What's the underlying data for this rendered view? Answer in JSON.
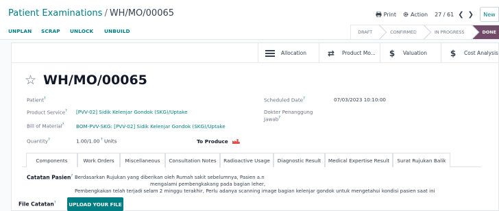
{
  "breadcrumb": {
    "parent": "Patient Examinations",
    "separator": "/",
    "current": "WH/MO/00065"
  },
  "control": {
    "print_label": "Print",
    "action_label": "Action",
    "pager": "27 / 61",
    "new_label": "New"
  },
  "statusbar": {
    "buttons": [
      "UNPLAN",
      "SCRAP",
      "UNLOCK",
      "UNBUILD"
    ],
    "stages": [
      "DRAFT",
      "CONFIRMED",
      "IN PROGRESS",
      "DONE"
    ],
    "active_stage": "DONE"
  },
  "smart_buttons": [
    {
      "icon": "list-icon",
      "label": "Allocation"
    },
    {
      "icon": "exchange-icon",
      "label": "Product Mo..."
    },
    {
      "icon": "dollar-icon",
      "label": "Valuation"
    },
    {
      "icon": "dollar-icon",
      "label": "Cost Analysis"
    }
  ],
  "record": {
    "name": "WH/MO/00065",
    "fields": {
      "patient_label": "Patient",
      "patient_value": "",
      "product_label": "Product Service",
      "product_value": "[PVV-02] Sidik Kelenjar Gondok (SKG)/Uptake",
      "bom_label": "Bill of Material",
      "bom_value": "BOM-PVV-SKG: [PVV-02] Sidik Kelenjar Gondok (SKG)/Uptake",
      "quantity_label": "Quantity",
      "quantity_value": "1.00/1.00",
      "quantity_unit": "Units",
      "to_produce_label": "To Produce",
      "scheduled_label": "Scheduled Date",
      "scheduled_value": "07/03/2023 10:10:00",
      "doctor_label_1": "Dokter Penanggung",
      "doctor_label_2": "Jawab"
    }
  },
  "tabs": [
    "Components",
    "Work Orders",
    "Miscellaneous",
    "Consultation Notes",
    "Radioactive Usage",
    "Diagnostic Result",
    "Medical Expertise Result",
    "Surat Rujukan Balik"
  ],
  "active_tab": "Consultation Notes",
  "consultation": {
    "notes_label": "Catatan Pasien",
    "notes_line1a": "Berdasarkan Rujukan yang diberikan oleh Rumah sakit sebelumnya, Pasien a.n",
    "notes_line1b": "mengalami pembengkakang pada bagian leher,",
    "notes_line2": "Pembengkakan telah terjadi selam 2 minggu terakhir, Perlu adanya scanning image bagian kelenjar gondok untuk mengetahui kondisi pasien saat ini",
    "file_label": "File Catatan",
    "upload_label": "UPLOAD YOUR FILE"
  },
  "colors": {
    "primary": "#017e84",
    "active_stage": "#714b67",
    "produce_icon": "#d9534f"
  }
}
